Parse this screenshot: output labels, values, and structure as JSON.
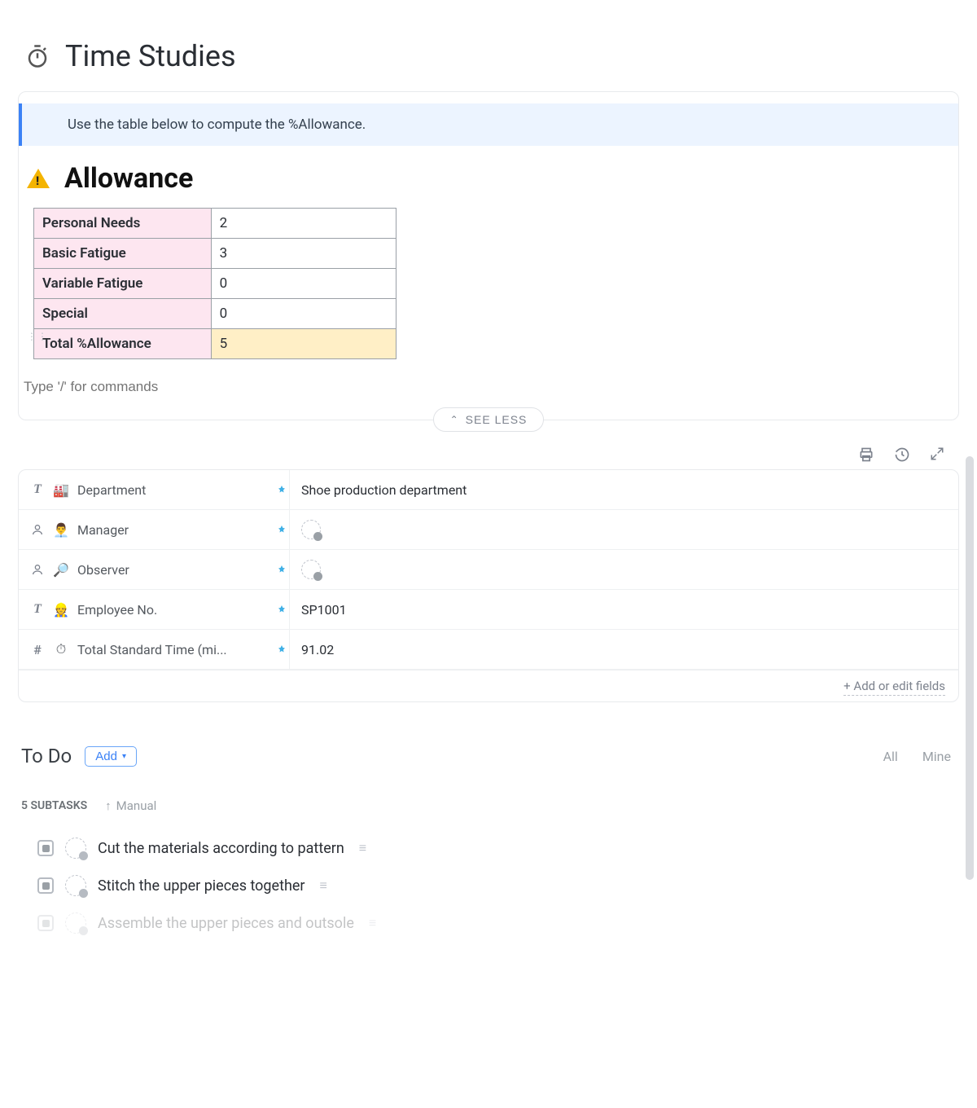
{
  "title": "Time Studies",
  "callout": "Use the table below to compute the %Allowance.",
  "allowance": {
    "heading": "Allowance",
    "rows": [
      {
        "label": "Personal Needs",
        "value": "2"
      },
      {
        "label": "Basic Fatigue",
        "value": "3"
      },
      {
        "label": "Variable Fatigue",
        "value": "0"
      },
      {
        "label": "Special",
        "value": "0"
      }
    ],
    "total_label": "Total %Allowance",
    "total_value": "5"
  },
  "command_placeholder": "Type '/' for commands",
  "see_less": "SEE LESS",
  "fields": [
    {
      "type": "T",
      "emoji": "🏭",
      "name": "Department",
      "value": "Shoe production department",
      "valueKind": "text"
    },
    {
      "type": "person",
      "emoji": "👨‍💼",
      "name": "Manager",
      "value": "",
      "valueKind": "avatar"
    },
    {
      "type": "person",
      "emoji": "🔎",
      "name": "Observer",
      "value": "",
      "valueKind": "avatar"
    },
    {
      "type": "T",
      "emoji": "👷",
      "name": "Employee No.",
      "value": "SP1001",
      "valueKind": "text"
    },
    {
      "type": "#",
      "emoji": "⏱",
      "name": "Total Standard Time (mi...",
      "value": "91.02",
      "valueKind": "text"
    }
  ],
  "add_fields": "+ Add or edit fields",
  "todo": {
    "heading": "To Do",
    "add": "Add",
    "filters": {
      "all": "All",
      "mine": "Mine"
    },
    "subtask_count": "5 SUBTASKS",
    "sort": "Manual",
    "items": [
      "Cut the materials according to pattern",
      "Stitch the upper pieces together",
      "Assemble the upper pieces and outsole"
    ]
  }
}
